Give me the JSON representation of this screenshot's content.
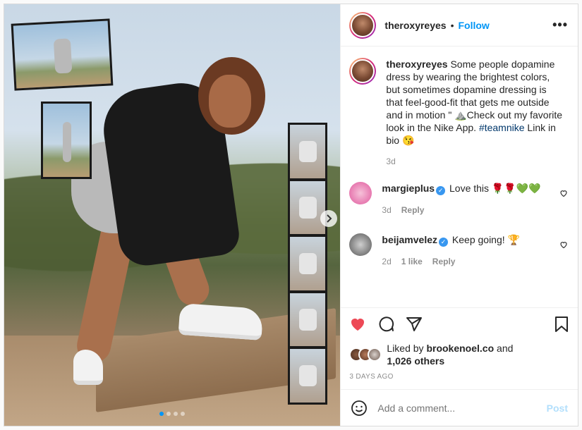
{
  "post": {
    "username": "theroxyreyes",
    "separator": "•",
    "follow_label": "Follow",
    "more_icon": "more-horizontal-icon",
    "caption_before_hashtag": "Some people dopamine dress by wearing the brightest colors, but sometimes dopamine dressing is that feel-good-fit that gets me outside and in motion \" ⛰️Check out my favorite look in the Nike App.",
    "hashtag": "#teamnike",
    "caption_after_hashtag": " Link in bio 😘",
    "caption_age": "3d",
    "carousel": {
      "slide_count": 4,
      "active_slide": 1,
      "next_icon": "chevron-right-icon"
    }
  },
  "comments": [
    {
      "username": "margieplus",
      "verified": true,
      "text": "Love this 🌹🌹💚💚",
      "age": "3d",
      "likes": "",
      "reply_label": "Reply"
    },
    {
      "username": "beijamvelez",
      "verified": true,
      "text": "Keep going! 🏆",
      "age": "2d",
      "likes": "1 like",
      "reply_label": "Reply"
    }
  ],
  "actions": {
    "like_icon": "heart-filled-icon",
    "like_color": "#ed4956",
    "comment_icon": "comment-icon",
    "share_icon": "paper-plane-icon",
    "save_icon": "bookmark-icon"
  },
  "likes": {
    "prefix": "Liked by ",
    "user": "brookenoel.co",
    "connector": " and",
    "others": "1,026 others"
  },
  "date": "3 DAYS AGO",
  "add_comment": {
    "placeholder": "Add a comment...",
    "post_label": "Post",
    "emoji_icon": "emoji-icon"
  }
}
